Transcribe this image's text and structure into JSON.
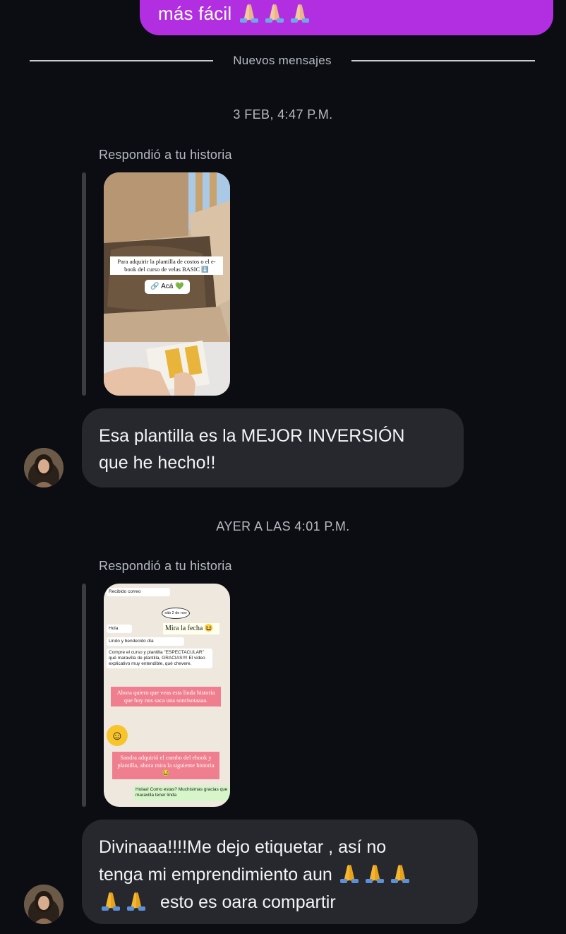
{
  "outgoing": {
    "text": "más fácil",
    "emoji_count": 3
  },
  "divider": {
    "label": "Nuevos mensajes"
  },
  "messages": [
    {
      "timestamp": "3 FEB, 4:47 P.M.",
      "reply_label": "Respondió a tu historia",
      "story": {
        "caption": "Para adquirir la plantilla de costos o el e-book del curso de velas BASIC ⬇️",
        "link_label": "Acá 💚"
      },
      "text_line1": "Esa plantilla es la MEJOR INVERSIÓN",
      "text_line2": "que he hecho!!"
    },
    {
      "timestamp": "AYER A LAS 4:01 P.M.",
      "reply_label": "Respondió a tu historia",
      "story": {
        "chat_recv": "Recibido correo",
        "date_chip": "sáb 2 de nov",
        "mira": "Mira la fecha 😆",
        "hola": "Hola",
        "lindo": "Lindo y bendecido día",
        "compre": "Compre el curso y plantilla \"ESPECTACULAR\" qué maravilla de plantilla, GRACIAS!!!! El video explicativo muy entendible, qué chevere.",
        "pink1": "Ahora quiero que veas esta linda historia que hoy nos saca una sonrisotaaaa.",
        "pink2": "Sandra adquirió el combo del ebook y plantilla, ahora mira la siguiente historia 😂",
        "green": "Holaa! Como estas? Muchisimas gracias que maravilla tener linda"
      },
      "text_line1": "Divinaaa!!!!Me dejo etiquetar , así no",
      "text_line2": "tenga mi emprendimiento aun",
      "text_line3": "esto es oara compartir"
    }
  ]
}
